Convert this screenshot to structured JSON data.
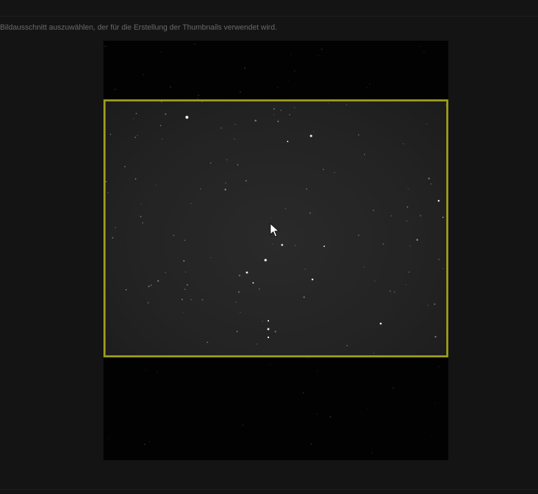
{
  "instruction_text": "Bildausschnitt auszuwählen, der für die Erstellung der Thumbnails verwendet wird.",
  "colors": {
    "background": "#141414",
    "crop_border": "#9a9a18",
    "text": "#6a6a6a"
  },
  "icons": {
    "cursor": "mouse-pointer-icon"
  }
}
